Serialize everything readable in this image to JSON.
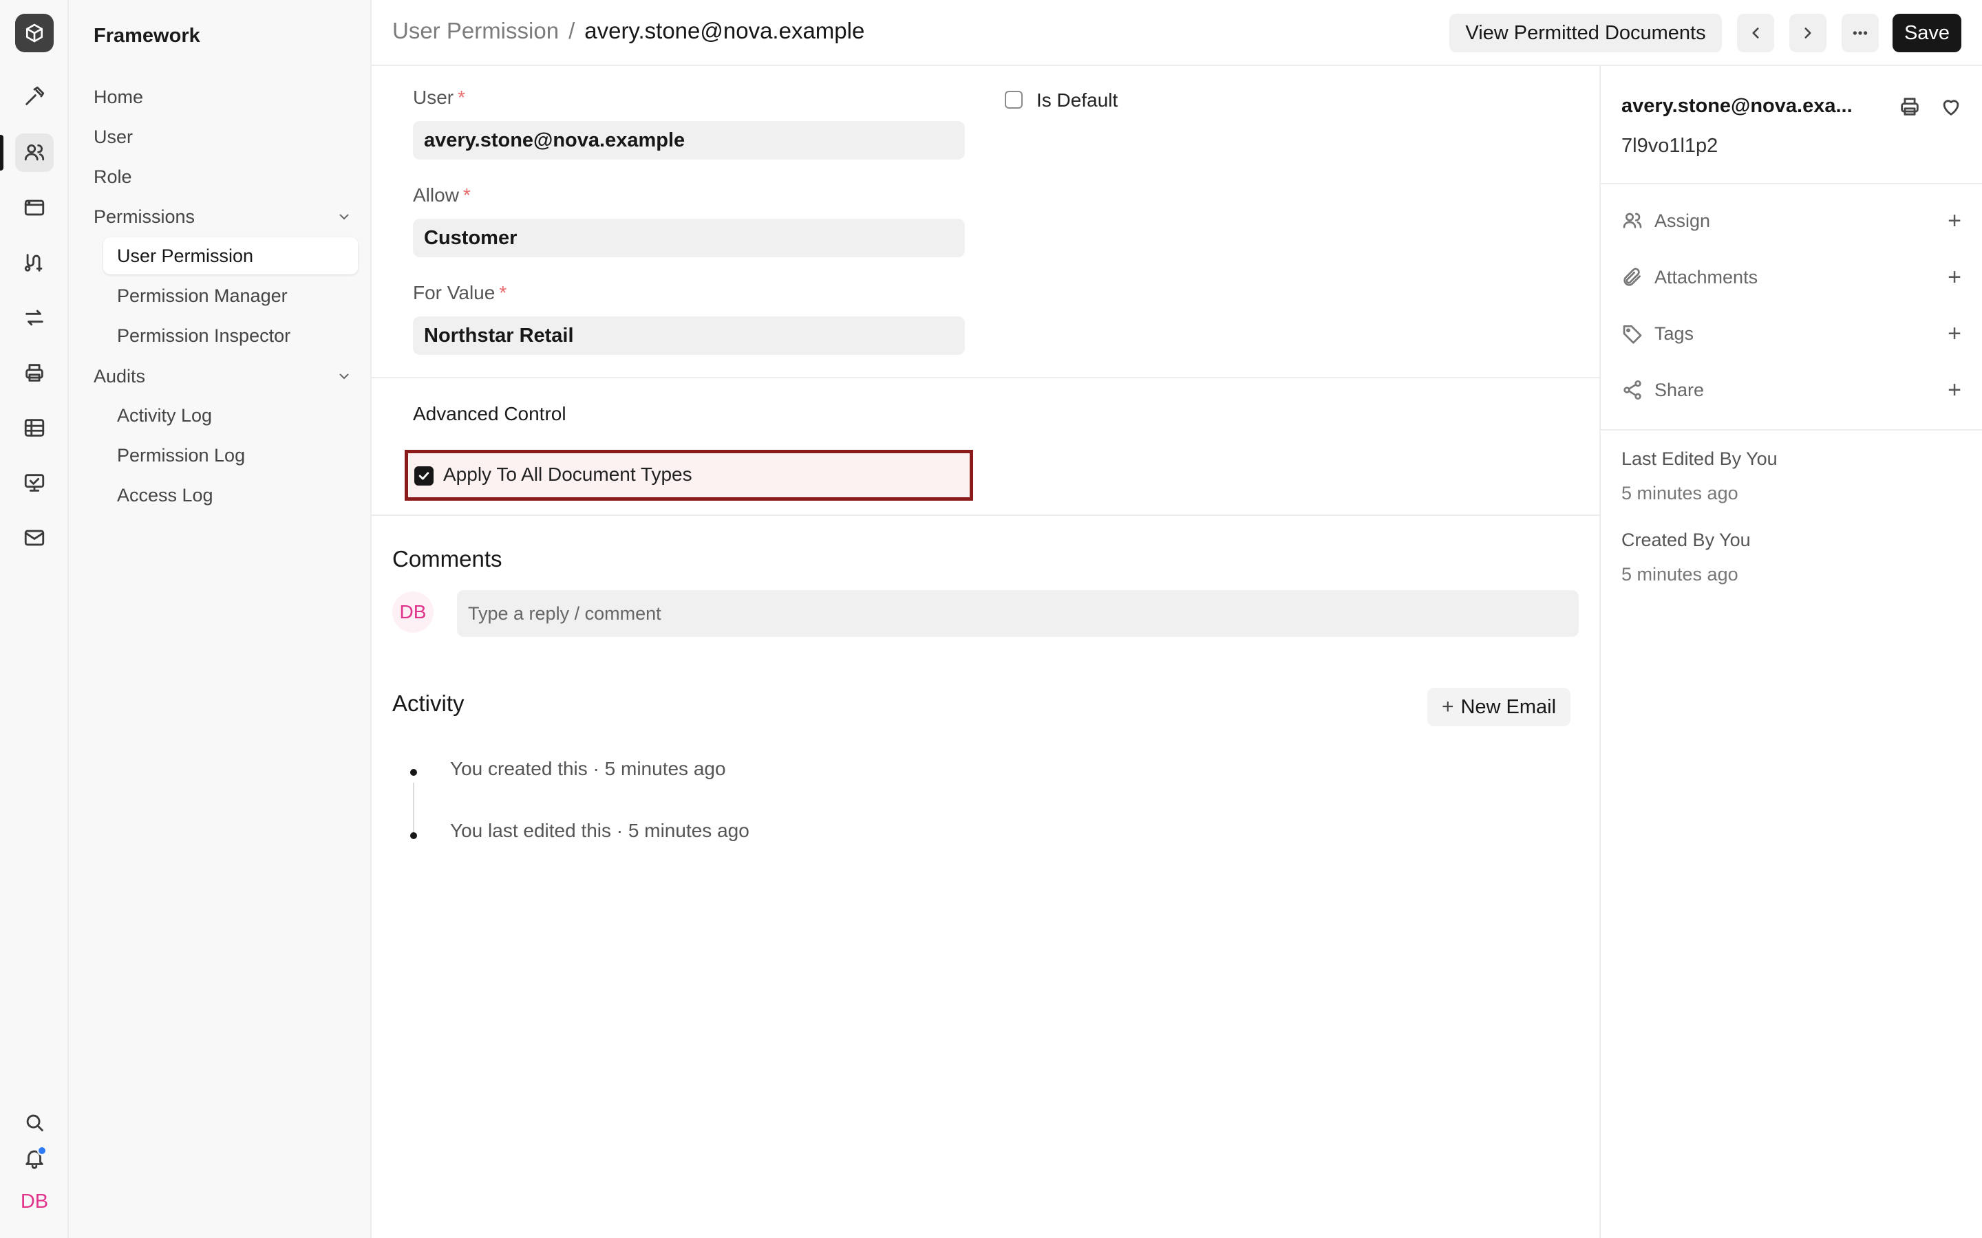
{
  "sidebar": {
    "title": "Framework",
    "items": [
      {
        "label": "Home"
      },
      {
        "label": "User"
      },
      {
        "label": "Role"
      }
    ],
    "groups": [
      {
        "label": "Permissions",
        "children": [
          "User Permission",
          "Permission Manager",
          "Permission Inspector"
        ]
      },
      {
        "label": "Audits",
        "children": [
          "Activity Log",
          "Permission Log",
          "Access Log"
        ]
      }
    ],
    "active_item": "User Permission"
  },
  "rail": {
    "icons": [
      "app-logo-icon",
      "hammer-icon",
      "users-icon",
      "browser-icon",
      "connections-icon",
      "arrows-swap-icon",
      "printer-icon",
      "table-icon",
      "monitor-icon",
      "mail-icon",
      "search-icon",
      "bell-icon"
    ],
    "avatar_initials": "DB"
  },
  "header": {
    "breadcrumb_parent": "User Permission",
    "breadcrumb_sep": "/",
    "breadcrumb_current": "avery.stone@nova.example",
    "view_docs_label": "View Permitted Documents",
    "save_label": "Save"
  },
  "form": {
    "user_label": "User",
    "user_value": "avery.stone@nova.example",
    "allow_label": "Allow",
    "allow_value": "Customer",
    "for_value_label": "For Value",
    "for_value_value": "Northstar Retail",
    "required_mark": "*",
    "is_default_label": "Is Default",
    "is_default_checked": false,
    "advanced_title": "Advanced Control",
    "apply_all_label": "Apply To All Document Types",
    "apply_all_checked": true
  },
  "comments": {
    "title": "Comments",
    "avatar_initials": "DB",
    "placeholder": "Type a reply / comment"
  },
  "activity": {
    "title": "Activity",
    "new_email_label": "New Email",
    "entries": [
      {
        "text": "You created this · 5 minutes ago"
      },
      {
        "text": "You last edited this · 5 minutes ago"
      }
    ]
  },
  "right_panel": {
    "title": "avery.stone@nova.exa...",
    "doc_id": "7l9vo1l1p2",
    "actions": [
      {
        "label": "Assign"
      },
      {
        "label": "Attachments"
      },
      {
        "label": "Tags"
      },
      {
        "label": "Share"
      }
    ],
    "last_edited_label": "Last Edited By You",
    "last_edited_time": "5 minutes ago",
    "created_label": "Created By You",
    "created_time": "5 minutes ago"
  },
  "colors": {
    "accent_dark": "#171717",
    "highlight_border": "#8b1a1a",
    "avatar_pink": "#e0338a",
    "notification_blue": "#2f7cf6"
  }
}
